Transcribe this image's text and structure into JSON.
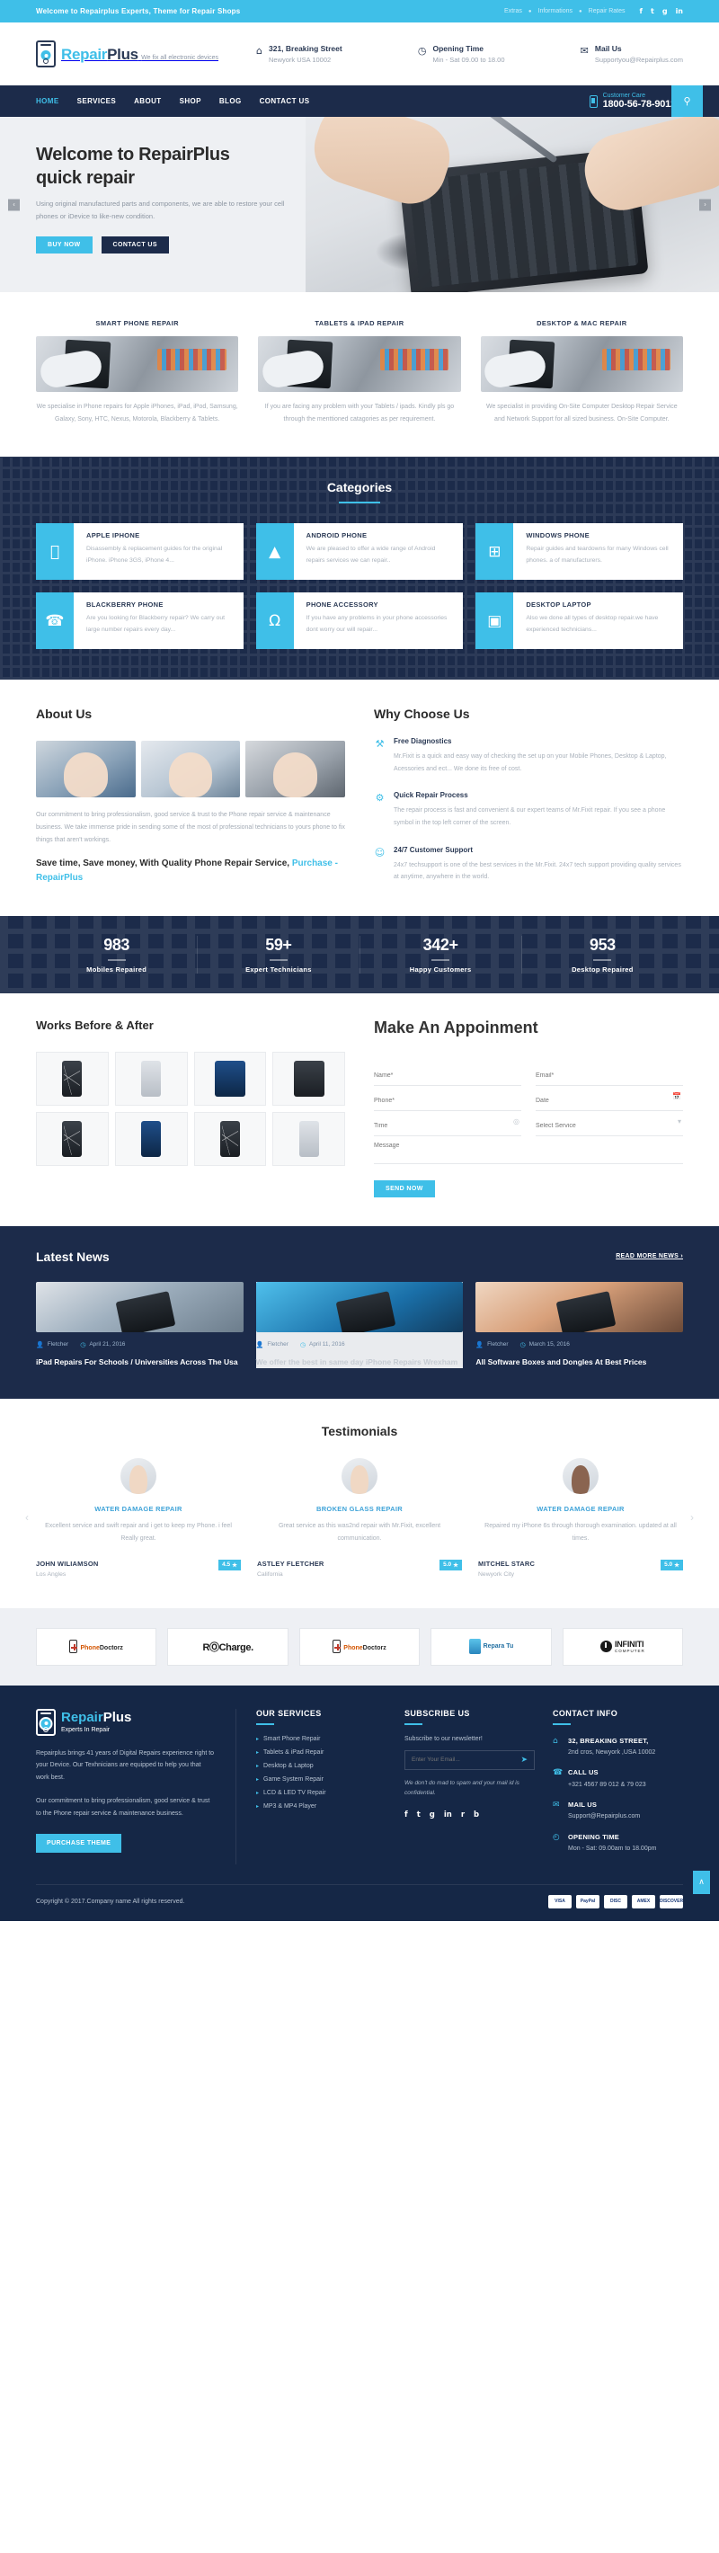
{
  "topbar": {
    "welcome": "Welcome to Repairplus Experts, Theme for Repair Shops",
    "links": [
      "Extras",
      "Informations",
      "Repair Rates"
    ],
    "socials": [
      "f",
      "t",
      "g",
      "in"
    ]
  },
  "header": {
    "logo_main": "Repair",
    "logo_accent": "Plus",
    "logo_tagline": "We fix all electronic devices",
    "infos": [
      {
        "icon": "home-icon",
        "title": "321, Breaking Street",
        "sub": "Newyork USA 10002"
      },
      {
        "icon": "clock-icon",
        "title": "Opening Time",
        "sub": "Min - Sat 09.00 to 18.00"
      },
      {
        "icon": "mail-icon",
        "title": "Mail Us",
        "sub": "Supportyou@Repairplus.com"
      }
    ]
  },
  "nav": {
    "items": [
      "HOME",
      "SERVICES",
      "ABOUT",
      "SHOP",
      "BLOG",
      "CONTACT US"
    ],
    "active": "HOME",
    "care_label": "Customer Care",
    "care_number": "1800-56-78-9012"
  },
  "hero": {
    "title_line1": "Welcome to RepairPlus",
    "title_line2": "quick repair",
    "desc": "Using original manufactured parts and components, we are able to restore your cell phones or iDevice to like-new condition.",
    "btn_primary": "BUY NOW",
    "btn_secondary": "CONTACT US",
    "prev": "‹",
    "next": "›"
  },
  "services": [
    {
      "title": "SMART PHONE REPAIR",
      "desc": "We specialise in Phone repairs for Apple iPhones, iPad, iPod, Samsung, Galaxy, Sony, HTC, Nexus, Motorola, Blackberry & Tablets."
    },
    {
      "title": "TABLETS & IPAD REPAIR",
      "desc": "If you are facing any problem with your Tablets / ipads. Kindly pls go through the menttioned catagories as per requirement."
    },
    {
      "title": "DESKTOP & MAC REPAIR",
      "desc": "We specialist in providing On-Site Computer Desktop Repair Service and Network Support for all sized business. On-Site Computer."
    }
  ],
  "categories": {
    "title": "Categories",
    "items": [
      {
        "icon": "",
        "name": "apple-icon",
        "title": "APPLE IPHONE",
        "desc": "Disassembly & replacement guides for the original iPhone. iPhone 3GS, iPhone 4..."
      },
      {
        "icon": "▲",
        "name": "android-icon",
        "title": "ANDROID PHONE",
        "desc": "We are pleased to offer a wide range of Android repairs services we can repair.."
      },
      {
        "icon": "⊞",
        "name": "windows-icon",
        "title": "WINDOWS PHONE",
        "desc": "Repair guides and teardowns for many Windows cell phones. a of manufacturers."
      },
      {
        "icon": "☎",
        "name": "blackberry-icon",
        "title": "BLACKBERRY PHONE",
        "desc": "Are you looking for Blackberry repair? We carry out large number repairs every day..."
      },
      {
        "icon": "Ω",
        "name": "headphone-icon",
        "title": "PHONE ACCESSORY",
        "desc": "If you have any problems in your phone accessories dont worry our will repair..."
      },
      {
        "icon": "▣",
        "name": "desktop-icon",
        "title": "DESKTOP LAPTOP",
        "desc": "Also we done all types of desktop repair.we have experienced technicians..."
      }
    ]
  },
  "about": {
    "title": "About Us",
    "body": "Our commitment to bring professionalism, good service & trust to the Phone repair service & maintenance business. We take immense pride in sending some of the most of professional technicians to yours phone to fix things that aren't workings.",
    "tagline_plain": "Save time, Save money, With Quality Phone Repair Service, ",
    "tagline_link": "Purchase - RepairPlus"
  },
  "why": {
    "title": "Why Choose Us",
    "features": [
      {
        "icon": "wrench-icon",
        "glyph": "⚒",
        "title": "Free Diagnostics",
        "desc": "Mr.Fixit is a quick and easy way of checking the set up on your Mobile Phones, Desktop & Laptop, Acessories and ect... We done its free of cost."
      },
      {
        "icon": "tools-icon",
        "glyph": "⚙",
        "title": "Quick Repair Process",
        "desc": "The repair process is fast and convenient & our expert teams of Mr.Fixit repair. If you see a phone symbol in the top left corner of the screen."
      },
      {
        "icon": "support-icon",
        "glyph": "☺",
        "title": "24/7 Customer Support",
        "desc": "24x7 techsupport is one of the best services in the Mr.Fixit. 24x7 tech support providing quality services at anytime, anywhere in the world."
      }
    ]
  },
  "counters": [
    {
      "num": "983",
      "label": "Mobiles Repaired"
    },
    {
      "num": "59+",
      "label": "Expert Technicians"
    },
    {
      "num": "342+",
      "label": "Happy Customers"
    },
    {
      "num": "953",
      "label": "Desktop Repaired"
    }
  ],
  "works": {
    "title": "Works Before & After"
  },
  "appointment": {
    "title": "Make An Appoinment",
    "fields": {
      "name": "Name*",
      "email": "Email*",
      "phone": "Phone*",
      "date": "Date",
      "time": "Time",
      "service": "Select Service",
      "message": "Message"
    },
    "date_icon": "Ὄ5",
    "time_icon": "◎",
    "service_icon": "▾",
    "submit": "SEND NOW"
  },
  "news": {
    "title": "Latest News",
    "more": "READ MORE NEWS ›",
    "posts": [
      {
        "author": "Fletcher",
        "date": "April 21, 2016",
        "title": "iPad Repairs For Schools / Universities Across The Usa"
      },
      {
        "author": "Fletcher",
        "date": "April 11, 2016",
        "title": "We offer the best in same day iPhone Repairs Wrexham"
      },
      {
        "author": "Fletcher",
        "date": "March 15, 2016",
        "title": "All Software Boxes and Dongles At Best Prices"
      }
    ]
  },
  "testimonials": {
    "title": "Testimonials",
    "items": [
      {
        "service": "WATER DAMAGE REPAIR",
        "quote": "Excellent service and swift repair and i get to keep my Phone. i feel Really great.",
        "name": "JOHN WILIAMSON",
        "city": "Los Angles",
        "rating": "4.5"
      },
      {
        "service": "BROKEN GLASS REPAIR",
        "quote": "Great service as this was2nd repair with Mr.Fixit, excellent communication.",
        "name": "ASTLEY FLETCHER",
        "city": "California",
        "rating": "5.0"
      },
      {
        "service": "WATER DAMAGE REPAIR",
        "quote": "Repaired my iPhone 6s through thorough examination. updated at all times.",
        "name": "MITCHEL STARC",
        "city": "Newyork City",
        "rating": "5.0"
      }
    ],
    "prev": "‹",
    "next": "›"
  },
  "brands": [
    {
      "type": "phonedoctorz",
      "l1": "Phone",
      "l2": "Doctorz"
    },
    {
      "type": "richarge",
      "l1": "RⓄCharge."
    },
    {
      "type": "phonedoctorz",
      "l1": "Phone",
      "l2": "Doctorz"
    },
    {
      "type": "reparatu",
      "l1": "Repara Tu"
    },
    {
      "type": "infiniti",
      "l1": "INFINITI",
      "l2": "COMPUTER"
    }
  ],
  "footer": {
    "logo_main": "Repair",
    "logo_accent": "Plus",
    "logo_tagline": "Experts In Repair",
    "about_p1": "Repairplus brings 41 years of Digital Repairs experience right to your Device. Our Texhnicians are equipped to help you that work best.",
    "about_p2": "Our commitment to bring professionalism, good service & trust to the Phone repair service & maintenance business.",
    "purchase": "PURCHASE THEME",
    "services_title": "OUR SERVICES",
    "services": [
      "Smart Phone Repair",
      "Tablets & iPad Repair",
      "Desktop & Laptop",
      "Game System Repair",
      "LCD & LED TV Repair",
      "MP3 & MP4 Player"
    ],
    "subscribe_title": "SUBSCRIBE US",
    "subscribe_text": "Subscribe to our newsletter!",
    "subscribe_placeholder": "Enter Your Email...",
    "subscribe_note": "We don't do mad to spam and your mail id is confidential.",
    "socials": [
      "f",
      "t",
      "g",
      "in",
      "r",
      "b"
    ],
    "contact_title": "CONTACT INFO",
    "contacts": [
      {
        "icon": "home-icon",
        "glyph": "⌂",
        "title": "32, BREAKING STREET,",
        "sub": "2nd cros, Newyork ,USA 10002"
      },
      {
        "icon": "phone-icon",
        "glyph": "☎",
        "title": "CALL US",
        "sub": "+321 4567 89 012 & 79 023"
      },
      {
        "icon": "mail-icon",
        "glyph": "✉",
        "title": "MAIL US",
        "sub": "Support@Repairplus.com"
      },
      {
        "icon": "clock-icon",
        "glyph": "◴",
        "title": "OPENING TIME",
        "sub": "Mon - Sat: 09.00am to 18.00pm"
      }
    ],
    "copyright": "Copyright © 2017.Company name All rights reserved.",
    "cards": [
      "VISA",
      "PayPal",
      "DISC",
      "AMEX",
      "DISCOVER"
    ],
    "to_top": "∧"
  },
  "colors": {
    "accent": "#3fbfe8",
    "navy": "#1c2b4a",
    "footer_navy": "#152746"
  }
}
